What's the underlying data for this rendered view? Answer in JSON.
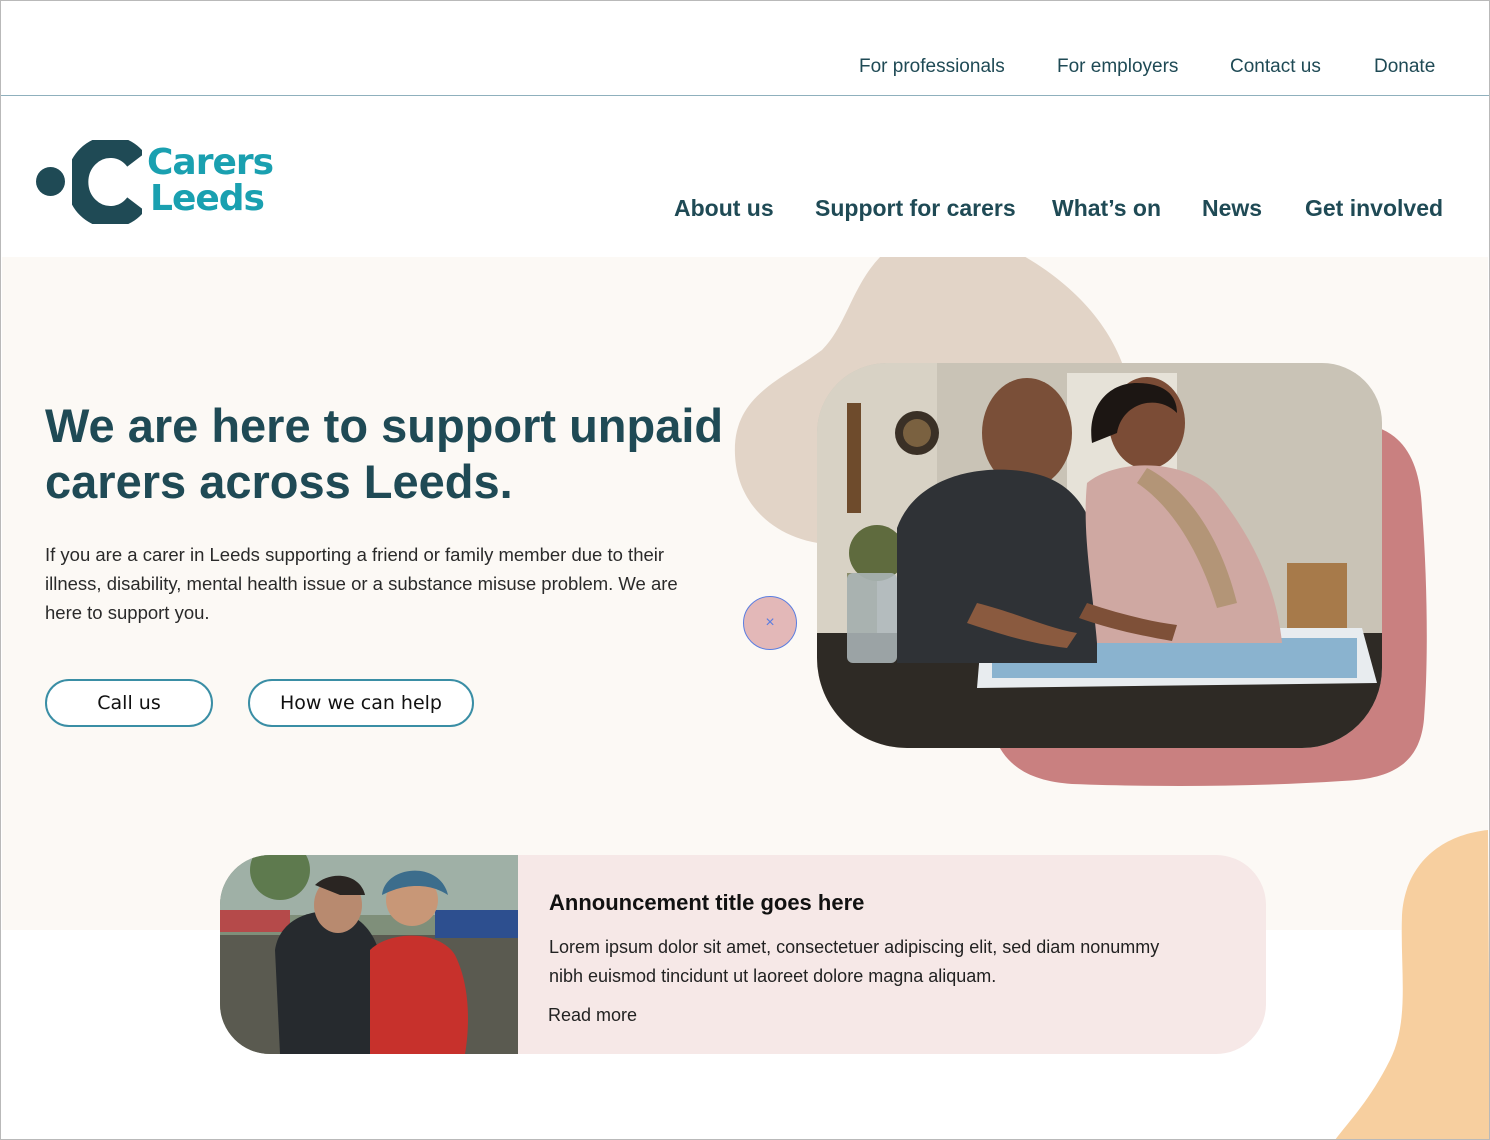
{
  "utility_nav": [
    "For professionals",
    "For employers",
    "Contact us",
    "Donate"
  ],
  "logo": {
    "word1": "Carers",
    "word2": "Leeds"
  },
  "main_nav": [
    "About us",
    "Support for carers",
    "What’s on",
    "News",
    "Get involved"
  ],
  "hero": {
    "heading": "We are here to support unpaid carers across Leeds.",
    "lede": "If you are a carer in Leeds supporting a friend or family member due to their illness, disability, mental health issue or a substance misuse problem. We are here to support you.",
    "buttons": {
      "call": "Call us",
      "help": "How we can help"
    }
  },
  "announcement": {
    "title": "Announcement title goes here",
    "body": "Lorem ipsum dolor sit amet, consectetuer adipiscing elit, sed diam nonummy nibh euismod tincidunt ut laoreet dolore magna aliquam.",
    "link": "Read more"
  },
  "close_glyph": "×",
  "colors": {
    "brand_dark": "#1f4a55",
    "brand_teal": "#1aa0b0",
    "hero_bg": "#fcf9f5",
    "blob_beige": "#e2d4c7",
    "blob_rose": "#c98080",
    "blob_peach": "#f7cf9f",
    "button_border": "#3a8ea5",
    "announcement_bg": "#f6e8e7"
  },
  "icons": [
    "close-icon"
  ]
}
